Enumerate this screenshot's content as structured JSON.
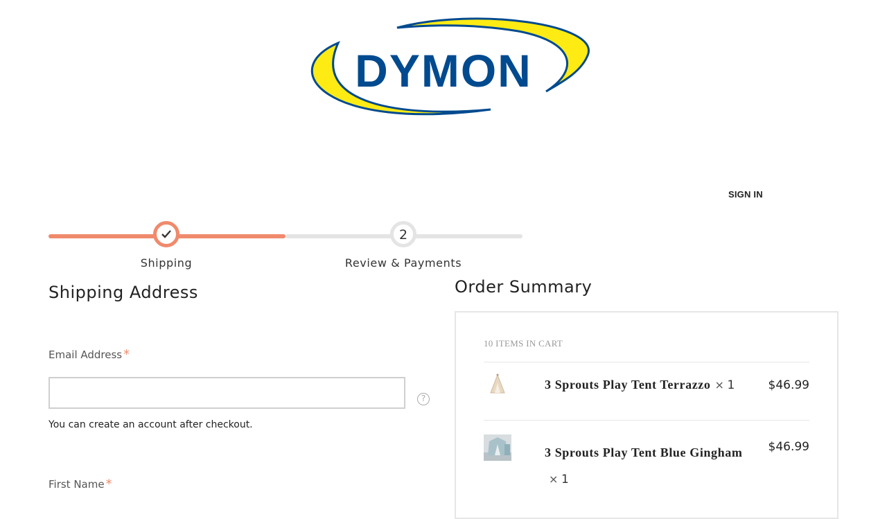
{
  "brand": {
    "logo_text": "DYMON",
    "colors": {
      "blue": "#004a8f",
      "yellow": "#ffeb14"
    }
  },
  "header": {
    "sign_in": "SIGN IN"
  },
  "progress": {
    "steps": [
      {
        "number": "1",
        "label": "Shipping",
        "state": "complete"
      },
      {
        "number": "2",
        "label": "Review & Payments",
        "state": "pending"
      }
    ],
    "accent_color": "#f08a6c"
  },
  "shipping": {
    "title": "Shipping Address",
    "email": {
      "label": "Email Address",
      "required_mark": "*",
      "value": "",
      "placeholder": "",
      "help_icon": "question-circle-icon",
      "note": "You can create an account after checkout."
    },
    "first_name": {
      "label": "First Name",
      "required_mark": "*"
    }
  },
  "summary": {
    "title": "Order Summary",
    "items_count": "10 ITEMS IN CART",
    "items": [
      {
        "name": "3 Sprouts Play Tent Terrazzo",
        "qty_symbol": "×",
        "qty": "1",
        "price": "$46.99",
        "thumb": "tent-beige-image"
      },
      {
        "name": "3 Sprouts Play Tent Blue Gingham",
        "qty_symbol": "×",
        "qty": "1",
        "price": "$46.99",
        "thumb": "tent-blue-image"
      }
    ]
  }
}
